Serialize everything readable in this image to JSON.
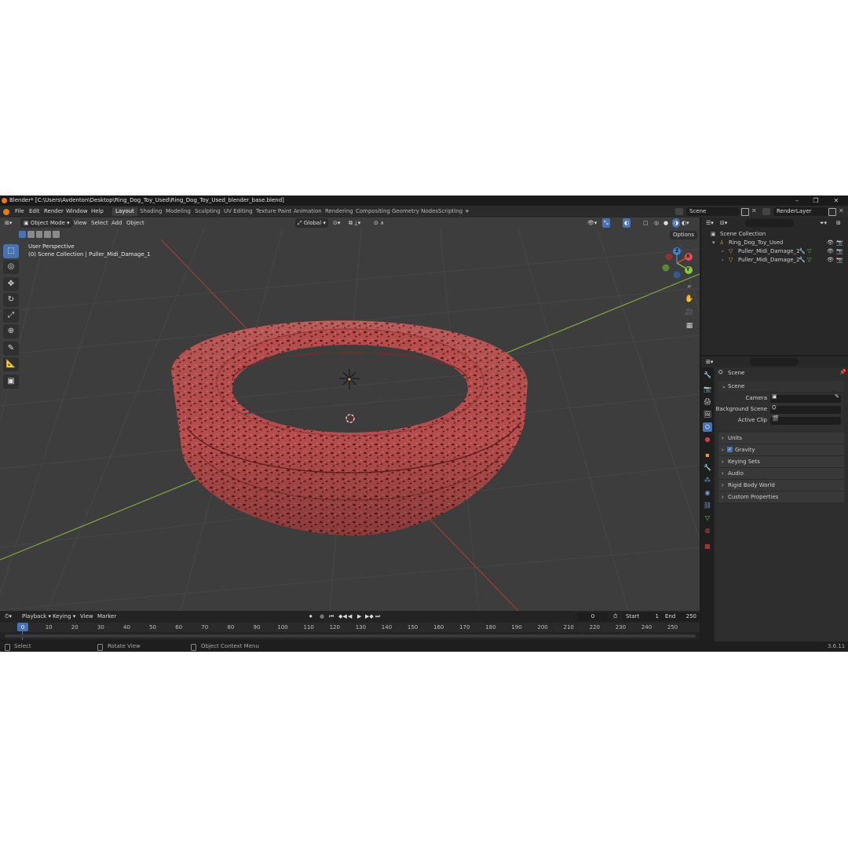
{
  "window": {
    "title": "Blender* [C:\\Users\\Avdenton\\Desktop\\Ring_Dog_Toy_Used\\Ring_Dog_Toy_Used_blender_base.blend]",
    "minimize": "–",
    "maximize": "❐",
    "close": "✕"
  },
  "menu": [
    "File",
    "Edit",
    "Render",
    "Window",
    "Help"
  ],
  "workspaces": [
    "Layout",
    "Shading",
    "Modeling",
    "Sculpting",
    "UV Editing",
    "Texture Paint",
    "Animation",
    "Rendering",
    "Compositing",
    "Geometry Nodes",
    "Scripting"
  ],
  "workspace_add": "+",
  "scene_field": "Scene",
  "viewlayer_field": "RenderLayer",
  "viewport": {
    "mode": "Object Mode",
    "menus": [
      "View",
      "Select",
      "Add",
      "Object"
    ],
    "transform_orientation": "Global",
    "options_label": "Options",
    "overlay_line1": "User Perspective",
    "overlay_line2": "(0) Scene Collection | Puller_Midi_Damage_1",
    "gizmo_axes": {
      "x": "X",
      "y": "Y",
      "z": "Z"
    },
    "colors": {
      "ring": "#b24b4a",
      "ring_dark": "#6e2424",
      "grid_bg": "#3d3d3d",
      "x_axis": "#a33a3a",
      "y_axis": "#7ea83a"
    }
  },
  "timeline": {
    "menus": [
      "Playback",
      "Keying",
      "View",
      "Marker"
    ],
    "current_frame": "0",
    "start_label": "Start",
    "start_value": "1",
    "end_label": "End",
    "end_value": "250",
    "ticks": [
      "0",
      "10",
      "20",
      "30",
      "40",
      "50",
      "60",
      "70",
      "80",
      "90",
      "100",
      "110",
      "120",
      "130",
      "140",
      "150",
      "160",
      "170",
      "180",
      "190",
      "200",
      "210",
      "220",
      "230",
      "240",
      "250"
    ]
  },
  "status": {
    "select": "Select",
    "rotate": "Rotate View",
    "context": "Object Context Menu",
    "version": "3.6.11"
  },
  "outliner": {
    "root": "Scene Collection",
    "items": [
      {
        "label": "Ring_Dog_Toy_Used"
      },
      {
        "label": "Puller_Midi_Damage_1"
      },
      {
        "label": "Puller_Midi_Damage_2"
      }
    ]
  },
  "properties": {
    "context_title": "Scene",
    "panel_title": "Scene",
    "camera_label": "Camera",
    "background_label": "Background Scene",
    "clip_label": "Active Clip",
    "sections": [
      "Units",
      "Gravity",
      "Keying Sets",
      "Audio",
      "Rigid Body World",
      "Custom Properties"
    ],
    "gravity_checked": true
  }
}
